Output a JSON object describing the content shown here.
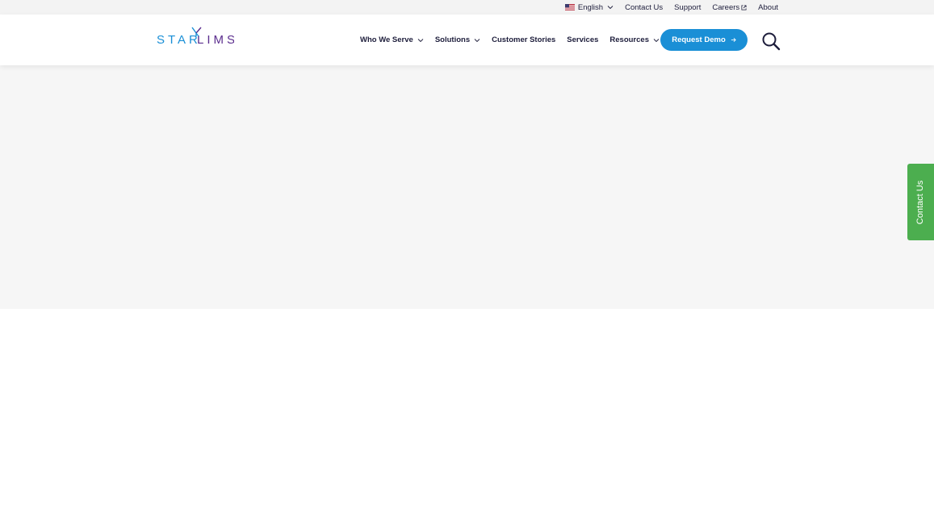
{
  "utility": {
    "language": "English",
    "contact": "Contact Us",
    "support": "Support",
    "careers": "Careers",
    "about": "About"
  },
  "logo": {
    "text_left": "STAR",
    "text_right": "LIMS"
  },
  "nav": {
    "items": [
      {
        "label": "Who We Serve",
        "dropdown": true
      },
      {
        "label": "Solutions",
        "dropdown": true
      },
      {
        "label": "Customer Stories",
        "dropdown": false
      },
      {
        "label": "Services",
        "dropdown": false
      },
      {
        "label": "Resources",
        "dropdown": true
      }
    ],
    "cta": "Request Demo"
  },
  "side_tab": {
    "label": "Contact Us"
  },
  "colors": {
    "accent_blue": "#1a8fd6",
    "logo_purple": "#5b2d8e",
    "side_tab_green": "#4cae4f",
    "text_dark": "#1d1d3b"
  },
  "icons": [
    "us-flag-icon",
    "chevron-down-icon",
    "external-link-icon",
    "arrow-right-icon",
    "search-icon"
  ]
}
